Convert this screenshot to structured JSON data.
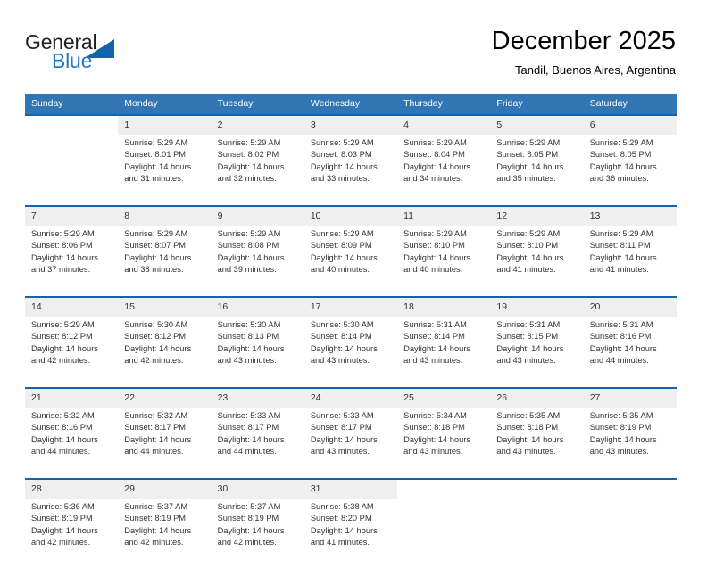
{
  "brand": {
    "name_part1": "General",
    "name_part2": "Blue",
    "accent_color": "#1464aa",
    "text_color": "#231f20"
  },
  "header": {
    "title": "December 2025",
    "subtitle": "Tandil, Buenos Aires, Argentina"
  },
  "calendar": {
    "header_bg": "#3275b5",
    "separator_color": "#1464aa",
    "daynum_bg": "#efefef",
    "weekdays": [
      "Sunday",
      "Monday",
      "Tuesday",
      "Wednesday",
      "Thursday",
      "Friday",
      "Saturday"
    ],
    "weeks": [
      [
        {
          "day": "",
          "l1": "",
          "l2": "",
          "l3": "",
          "l4": ""
        },
        {
          "day": "1",
          "l1": "Sunrise: 5:29 AM",
          "l2": "Sunset: 8:01 PM",
          "l3": "Daylight: 14 hours",
          "l4": "and 31 minutes."
        },
        {
          "day": "2",
          "l1": "Sunrise: 5:29 AM",
          "l2": "Sunset: 8:02 PM",
          "l3": "Daylight: 14 hours",
          "l4": "and 32 minutes."
        },
        {
          "day": "3",
          "l1": "Sunrise: 5:29 AM",
          "l2": "Sunset: 8:03 PM",
          "l3": "Daylight: 14 hours",
          "l4": "and 33 minutes."
        },
        {
          "day": "4",
          "l1": "Sunrise: 5:29 AM",
          "l2": "Sunset: 8:04 PM",
          "l3": "Daylight: 14 hours",
          "l4": "and 34 minutes."
        },
        {
          "day": "5",
          "l1": "Sunrise: 5:29 AM",
          "l2": "Sunset: 8:05 PM",
          "l3": "Daylight: 14 hours",
          "l4": "and 35 minutes."
        },
        {
          "day": "6",
          "l1": "Sunrise: 5:29 AM",
          "l2": "Sunset: 8:05 PM",
          "l3": "Daylight: 14 hours",
          "l4": "and 36 minutes."
        }
      ],
      [
        {
          "day": "7",
          "l1": "Sunrise: 5:29 AM",
          "l2": "Sunset: 8:06 PM",
          "l3": "Daylight: 14 hours",
          "l4": "and 37 minutes."
        },
        {
          "day": "8",
          "l1": "Sunrise: 5:29 AM",
          "l2": "Sunset: 8:07 PM",
          "l3": "Daylight: 14 hours",
          "l4": "and 38 minutes."
        },
        {
          "day": "9",
          "l1": "Sunrise: 5:29 AM",
          "l2": "Sunset: 8:08 PM",
          "l3": "Daylight: 14 hours",
          "l4": "and 39 minutes."
        },
        {
          "day": "10",
          "l1": "Sunrise: 5:29 AM",
          "l2": "Sunset: 8:09 PM",
          "l3": "Daylight: 14 hours",
          "l4": "and 40 minutes."
        },
        {
          "day": "11",
          "l1": "Sunrise: 5:29 AM",
          "l2": "Sunset: 8:10 PM",
          "l3": "Daylight: 14 hours",
          "l4": "and 40 minutes."
        },
        {
          "day": "12",
          "l1": "Sunrise: 5:29 AM",
          "l2": "Sunset: 8:10 PM",
          "l3": "Daylight: 14 hours",
          "l4": "and 41 minutes."
        },
        {
          "day": "13",
          "l1": "Sunrise: 5:29 AM",
          "l2": "Sunset: 8:11 PM",
          "l3": "Daylight: 14 hours",
          "l4": "and 41 minutes."
        }
      ],
      [
        {
          "day": "14",
          "l1": "Sunrise: 5:29 AM",
          "l2": "Sunset: 8:12 PM",
          "l3": "Daylight: 14 hours",
          "l4": "and 42 minutes."
        },
        {
          "day": "15",
          "l1": "Sunrise: 5:30 AM",
          "l2": "Sunset: 8:12 PM",
          "l3": "Daylight: 14 hours",
          "l4": "and 42 minutes."
        },
        {
          "day": "16",
          "l1": "Sunrise: 5:30 AM",
          "l2": "Sunset: 8:13 PM",
          "l3": "Daylight: 14 hours",
          "l4": "and 43 minutes."
        },
        {
          "day": "17",
          "l1": "Sunrise: 5:30 AM",
          "l2": "Sunset: 8:14 PM",
          "l3": "Daylight: 14 hours",
          "l4": "and 43 minutes."
        },
        {
          "day": "18",
          "l1": "Sunrise: 5:31 AM",
          "l2": "Sunset: 8:14 PM",
          "l3": "Daylight: 14 hours",
          "l4": "and 43 minutes."
        },
        {
          "day": "19",
          "l1": "Sunrise: 5:31 AM",
          "l2": "Sunset: 8:15 PM",
          "l3": "Daylight: 14 hours",
          "l4": "and 43 minutes."
        },
        {
          "day": "20",
          "l1": "Sunrise: 5:31 AM",
          "l2": "Sunset: 8:16 PM",
          "l3": "Daylight: 14 hours",
          "l4": "and 44 minutes."
        }
      ],
      [
        {
          "day": "21",
          "l1": "Sunrise: 5:32 AM",
          "l2": "Sunset: 8:16 PM",
          "l3": "Daylight: 14 hours",
          "l4": "and 44 minutes."
        },
        {
          "day": "22",
          "l1": "Sunrise: 5:32 AM",
          "l2": "Sunset: 8:17 PM",
          "l3": "Daylight: 14 hours",
          "l4": "and 44 minutes."
        },
        {
          "day": "23",
          "l1": "Sunrise: 5:33 AM",
          "l2": "Sunset: 8:17 PM",
          "l3": "Daylight: 14 hours",
          "l4": "and 44 minutes."
        },
        {
          "day": "24",
          "l1": "Sunrise: 5:33 AM",
          "l2": "Sunset: 8:17 PM",
          "l3": "Daylight: 14 hours",
          "l4": "and 43 minutes."
        },
        {
          "day": "25",
          "l1": "Sunrise: 5:34 AM",
          "l2": "Sunset: 8:18 PM",
          "l3": "Daylight: 14 hours",
          "l4": "and 43 minutes."
        },
        {
          "day": "26",
          "l1": "Sunrise: 5:35 AM",
          "l2": "Sunset: 8:18 PM",
          "l3": "Daylight: 14 hours",
          "l4": "and 43 minutes."
        },
        {
          "day": "27",
          "l1": "Sunrise: 5:35 AM",
          "l2": "Sunset: 8:19 PM",
          "l3": "Daylight: 14 hours",
          "l4": "and 43 minutes."
        }
      ],
      [
        {
          "day": "28",
          "l1": "Sunrise: 5:36 AM",
          "l2": "Sunset: 8:19 PM",
          "l3": "Daylight: 14 hours",
          "l4": "and 42 minutes."
        },
        {
          "day": "29",
          "l1": "Sunrise: 5:37 AM",
          "l2": "Sunset: 8:19 PM",
          "l3": "Daylight: 14 hours",
          "l4": "and 42 minutes."
        },
        {
          "day": "30",
          "l1": "Sunrise: 5:37 AM",
          "l2": "Sunset: 8:19 PM",
          "l3": "Daylight: 14 hours",
          "l4": "and 42 minutes."
        },
        {
          "day": "31",
          "l1": "Sunrise: 5:38 AM",
          "l2": "Sunset: 8:20 PM",
          "l3": "Daylight: 14 hours",
          "l4": "and 41 minutes."
        },
        {
          "day": "",
          "l1": "",
          "l2": "",
          "l3": "",
          "l4": ""
        },
        {
          "day": "",
          "l1": "",
          "l2": "",
          "l3": "",
          "l4": ""
        },
        {
          "day": "",
          "l1": "",
          "l2": "",
          "l3": "",
          "l4": ""
        }
      ]
    ]
  }
}
